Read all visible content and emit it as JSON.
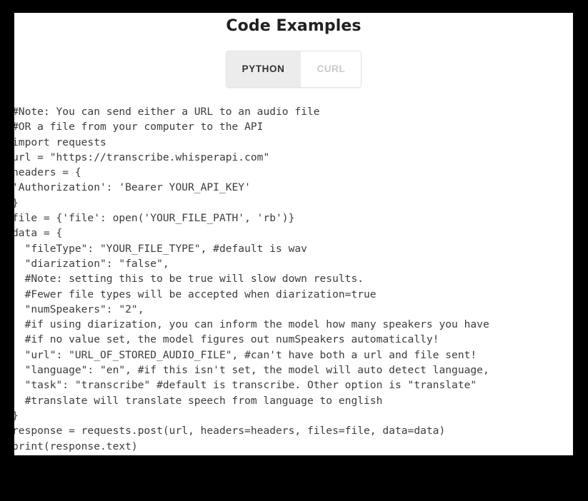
{
  "window": {
    "frame_color": "#000000",
    "page_background": "#ffffff"
  },
  "header": {
    "title": "Code Examples"
  },
  "tabs": {
    "active_index": 0,
    "items": [
      {
        "label": "PYTHON",
        "active": true
      },
      {
        "label": "CURL",
        "active": false
      }
    ]
  },
  "code": {
    "language": "python",
    "text": "#Note: You can send either a URL to an audio file\n#OR a file from your computer to the API\nimport requests\nurl = \"https://transcribe.whisperapi.com\"\nheaders = {\n'Authorization': 'Bearer YOUR_API_KEY'\n}\nfile = {'file': open('YOUR_FILE_PATH', 'rb')}\ndata = {\n  \"fileType\": \"YOUR_FILE_TYPE\", #default is wav\n  \"diarization\": \"false\",\n  #Note: setting this to be true will slow down results.\n  #Fewer file types will be accepted when diarization=true\n  \"numSpeakers\": \"2\",\n  #if using diarization, you can inform the model how many speakers you have\n  #if no value set, the model figures out numSpeakers automatically!\n  \"url\": \"URL_OF_STORED_AUDIO_FILE\", #can't have both a url and file sent!\n  \"language\": \"en\", #if this isn't set, the model will auto detect language,\n  \"task\": \"transcribe\" #default is transcribe. Other option is \"translate\"\n  #translate will translate speech from language to english\n}\nresponse = requests.post(url, headers=headers, files=file, data=data)\nprint(response.text)"
  },
  "colors": {
    "title_text": "#202020",
    "code_text": "#3c3c3c",
    "tab_active_bg": "#ececec",
    "tab_active_text": "#333333",
    "tab_inactive_bg": "#ffffff",
    "tab_inactive_text": "#c9c9c9",
    "tab_border": "#e3e3e3"
  }
}
